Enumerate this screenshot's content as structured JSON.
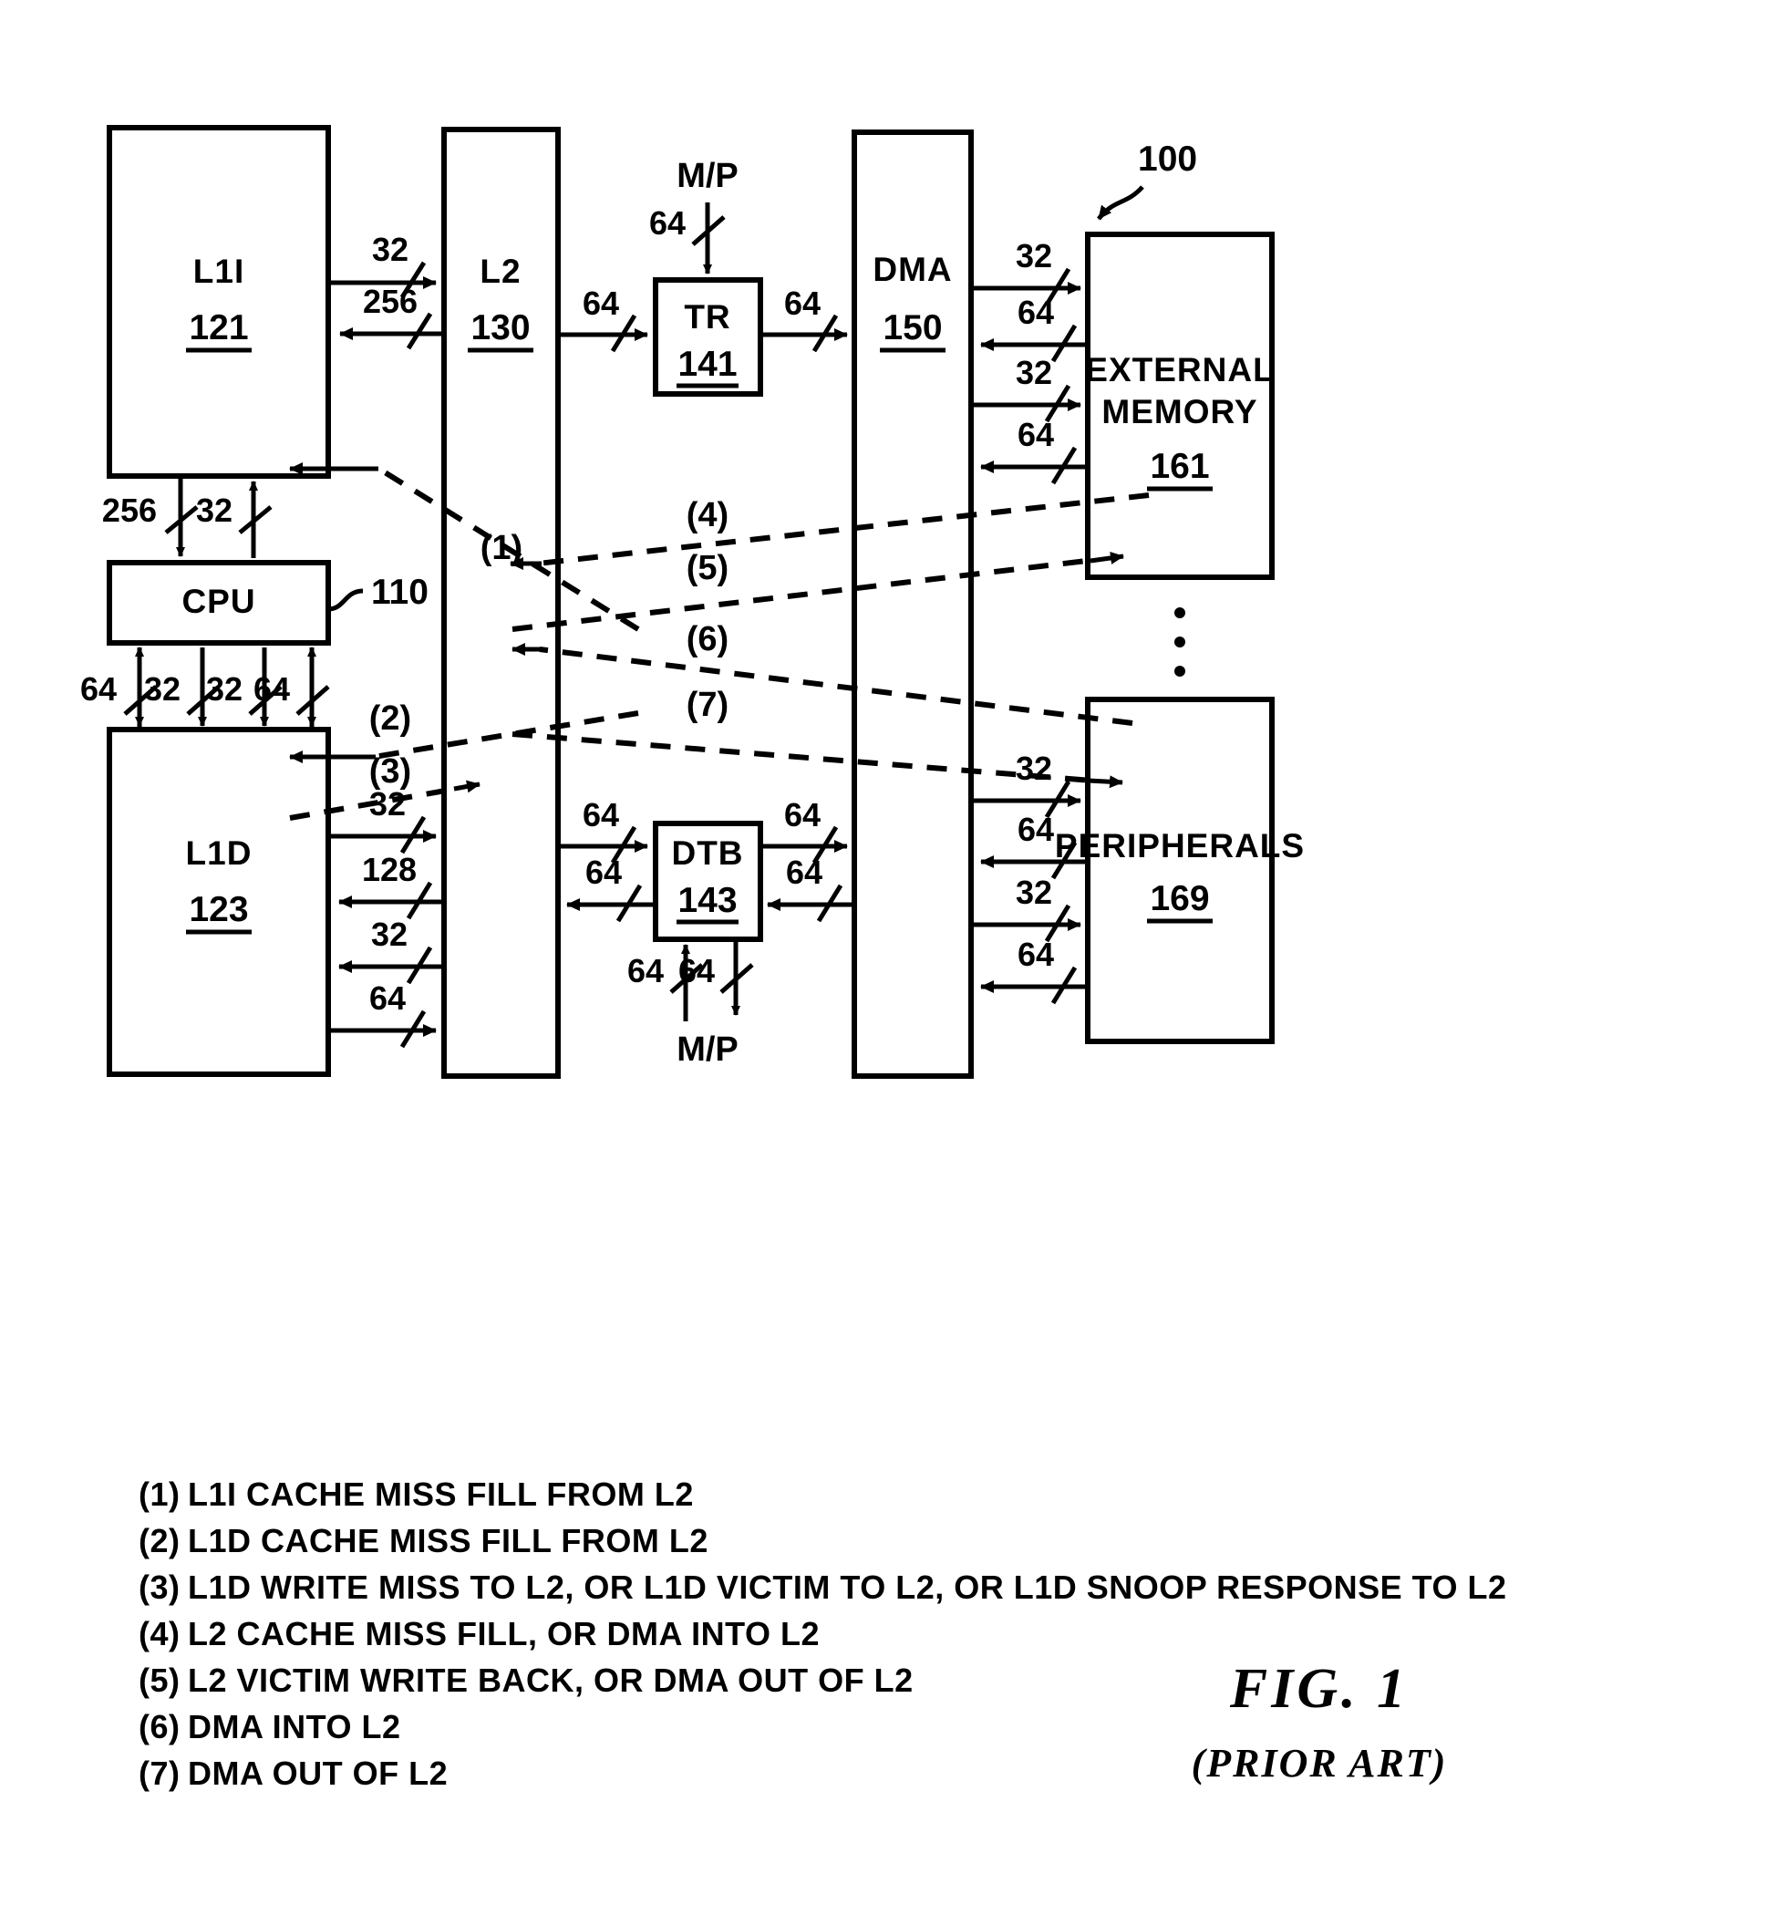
{
  "figure": {
    "label": "FIG. 1",
    "sublabel": "(PRIOR ART)",
    "system_ref": "100"
  },
  "blocks": {
    "l1i": {
      "name": "L1I",
      "ref": "121"
    },
    "l2": {
      "name": "L2",
      "ref": "130"
    },
    "tr": {
      "name": "TR",
      "ref": "141"
    },
    "dma": {
      "name": "DMA",
      "ref": "150"
    },
    "extmem": {
      "name_line1": "EXTERNAL",
      "name_line2": "MEMORY",
      "ref": "161"
    },
    "cpu": {
      "name": "CPU",
      "ref": "110"
    },
    "l1d": {
      "name": "L1D",
      "ref": "123"
    },
    "dtb": {
      "name": "DTB",
      "ref": "143"
    },
    "periph": {
      "name": "PERIPHERALS",
      "ref": "169"
    }
  },
  "ports": {
    "mp_top": "M/P",
    "mp_bottom": "M/P"
  },
  "bus_widths": {
    "l1i_to_l2": "32",
    "l2_to_l1i": "256",
    "l2_to_tr": "64",
    "tr_to_dma": "64",
    "mp_to_tr": "64",
    "dma_to_extmem_a": "32",
    "extmem_to_dma_a": "64",
    "dma_to_extmem_b": "32",
    "extmem_to_dma_b": "64",
    "l1i_to_cpu": "256",
    "cpu_to_l1i": "32",
    "cpu_l1d_1": "64",
    "cpu_l1d_2": "32",
    "cpu_l1d_3": "32",
    "cpu_l1d_4": "64",
    "l1d_to_l2_a": "32",
    "l2_to_l1d_a": "128",
    "l2_to_l1d_b": "32",
    "l1d_to_l2_b": "64",
    "l2_to_dtb": "64",
    "dtb_to_l2": "64",
    "dtb_to_dma": "64",
    "dma_to_dtb": "64",
    "mp_dtb_in": "64",
    "mp_dtb_out": "64",
    "dma_to_periph_a": "32",
    "periph_to_dma_a": "64",
    "dma_to_periph_b": "32",
    "periph_to_dma_b": "64"
  },
  "flow_tags": {
    "f1": "(1)",
    "f2": "(2)",
    "f3": "(3)",
    "f4": "(4)",
    "f5": "(5)",
    "f6": "(6)",
    "f7": "(7)"
  },
  "legend": [
    {
      "num": "(1)",
      "text": "L1I CACHE MISS FILL FROM L2"
    },
    {
      "num": "(2)",
      "text": "L1D CACHE MISS FILL FROM L2"
    },
    {
      "num": "(3)",
      "text": "L1D WRITE MISS TO L2, OR L1D VICTIM TO L2, OR L1D SNOOP RESPONSE TO L2"
    },
    {
      "num": "(4)",
      "text": "L2 CACHE MISS FILL, OR DMA INTO L2"
    },
    {
      "num": "(5)",
      "text": "L2 VICTIM WRITE BACK, OR DMA OUT OF L2"
    },
    {
      "num": "(6)",
      "text": "DMA INTO L2"
    },
    {
      "num": "(7)",
      "text": "DMA OUT OF L2"
    }
  ]
}
